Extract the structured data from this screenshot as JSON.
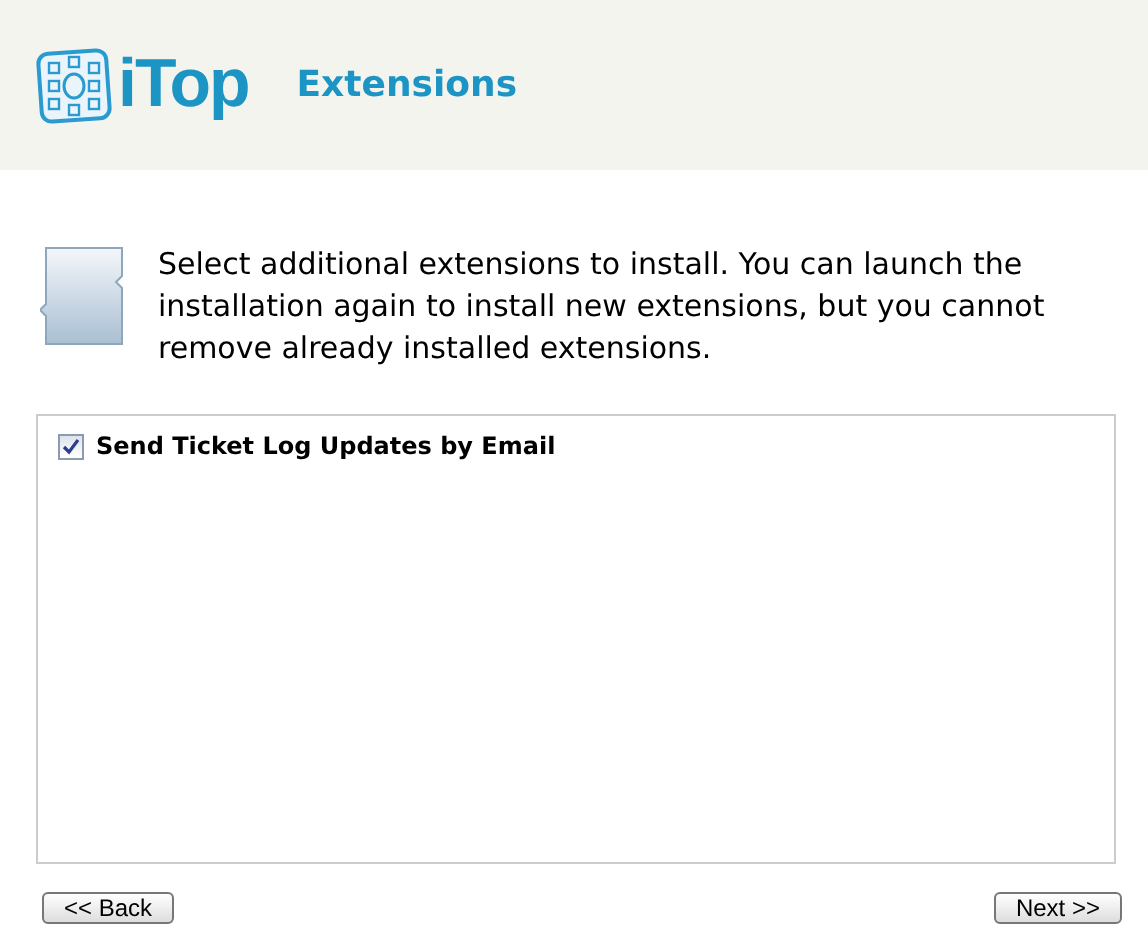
{
  "header": {
    "logo_text": "iTop",
    "title": "Extensions"
  },
  "intro": "Select additional extensions to install. You can launch the installation again to install new extensions, but you cannot remove already installed extensions.",
  "extensions": [
    {
      "label": "Send Ticket Log Updates by Email",
      "checked": true
    }
  ],
  "buttons": {
    "back": "<< Back",
    "next": "Next >>"
  }
}
